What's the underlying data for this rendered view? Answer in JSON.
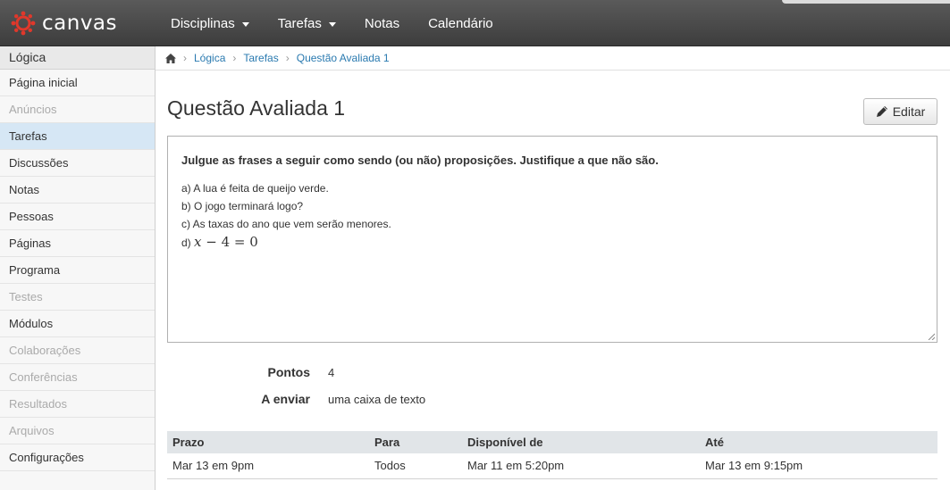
{
  "brand": {
    "name": "canvas",
    "accent": "#e0382b"
  },
  "nav": {
    "items": [
      {
        "label": "Disciplinas",
        "dropdown": true
      },
      {
        "label": "Tarefas",
        "dropdown": true
      },
      {
        "label": "Notas",
        "dropdown": false
      },
      {
        "label": "Calendário",
        "dropdown": false
      }
    ]
  },
  "sidebar": {
    "course": "Lógica",
    "items": [
      {
        "label": "Página inicial",
        "state": "normal"
      },
      {
        "label": "Anúncios",
        "state": "disabled"
      },
      {
        "label": "Tarefas",
        "state": "active"
      },
      {
        "label": "Discussões",
        "state": "normal"
      },
      {
        "label": "Notas",
        "state": "normal"
      },
      {
        "label": "Pessoas",
        "state": "normal"
      },
      {
        "label": "Páginas",
        "state": "normal"
      },
      {
        "label": "Programa",
        "state": "normal"
      },
      {
        "label": "Testes",
        "state": "disabled"
      },
      {
        "label": "Módulos",
        "state": "normal"
      },
      {
        "label": "Colaborações",
        "state": "disabled"
      },
      {
        "label": "Conferências",
        "state": "disabled"
      },
      {
        "label": "Resultados",
        "state": "disabled"
      },
      {
        "label": "Arquivos",
        "state": "disabled"
      },
      {
        "label": "Configurações",
        "state": "normal"
      }
    ]
  },
  "breadcrumb": {
    "home_icon": "home-icon",
    "items": [
      "Lógica",
      "Tarefas",
      "Questão Avaliada 1"
    ]
  },
  "assignment": {
    "title": "Questão Avaliada 1",
    "edit_label": "Editar",
    "description": {
      "heading": "Julgue as frases a seguir como sendo (ou não) proposições. Justifique a que não são.",
      "lines": [
        "a) A lua é feita de queijo verde.",
        "b) O jogo terminará logo?",
        "c) As taxas do ano que vem serão menores."
      ],
      "math_prefix": "d)",
      "math": {
        "var": "x",
        "rest": "− 4 = 0"
      }
    },
    "points_label": "Pontos",
    "points_value": "4",
    "submit_label": "A enviar",
    "submit_value": "uma caixa de texto"
  },
  "due_table": {
    "headers": [
      "Prazo",
      "Para",
      "Disponível de",
      "Até"
    ],
    "rows": [
      [
        "Mar 13 em 9pm",
        "Todos",
        "Mar 11 em 5:20pm",
        "Mar 13 em 9:15pm"
      ]
    ]
  }
}
